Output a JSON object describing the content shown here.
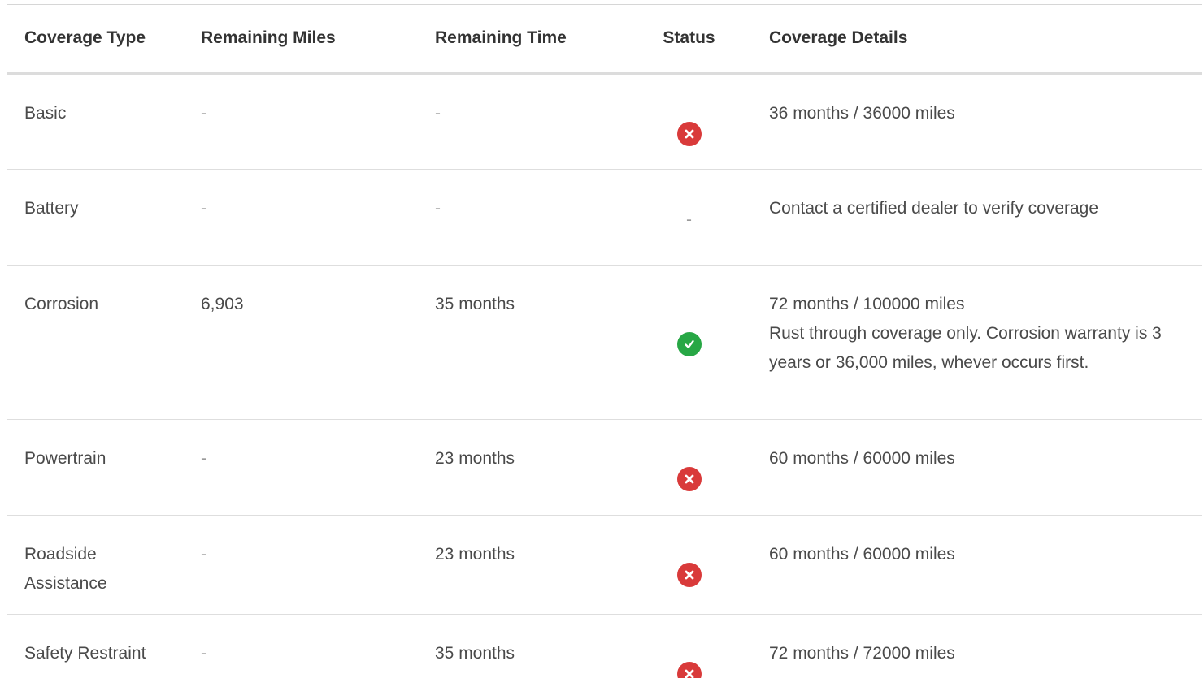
{
  "table": {
    "headers": {
      "coverage_type": "Coverage Type",
      "remaining_miles": "Remaining Miles",
      "remaining_time": "Remaining Time",
      "status": "Status",
      "coverage_details": "Coverage Details"
    },
    "rows": [
      {
        "coverage_type": "Basic",
        "remaining_miles": "-",
        "remaining_time": "-",
        "status": "fail",
        "status_text": "",
        "details_line1": "36 months / 36000 miles",
        "details_line2": ""
      },
      {
        "coverage_type": "Battery",
        "remaining_miles": "-",
        "remaining_time": "-",
        "status": "none",
        "status_text": "-",
        "details_line1": "Contact a certified dealer to verify coverage",
        "details_line2": ""
      },
      {
        "coverage_type": "Corrosion",
        "remaining_miles": "6,903",
        "remaining_time": "35 months",
        "status": "pass",
        "status_text": "",
        "details_line1": "72 months / 100000 miles",
        "details_line2": "Rust through coverage only. Corrosion warranty is 3 years or 36,000 miles, whever occurs first."
      },
      {
        "coverage_type": "Powertrain",
        "remaining_miles": "-",
        "remaining_time": "23 months",
        "status": "fail",
        "status_text": "",
        "details_line1": "60 months / 60000 miles",
        "details_line2": ""
      },
      {
        "coverage_type": "Roadside Assistance",
        "remaining_miles": "-",
        "remaining_time": "23 months",
        "status": "fail",
        "status_text": "",
        "details_line1": "60 months / 60000 miles",
        "details_line2": ""
      },
      {
        "coverage_type": "Safety Restraint",
        "remaining_miles": "-",
        "remaining_time": "35 months",
        "status": "fail",
        "status_text": "",
        "details_line1": "72 months / 72000 miles",
        "details_line2": ""
      }
    ]
  },
  "colors": {
    "fail_icon": "#d93a3a",
    "pass_icon": "#27a745",
    "header_text": "#333333",
    "body_text": "#4a4a4a",
    "row_divider": "#dedede"
  },
  "icons": {
    "fail": "x-circle-icon",
    "pass": "check-circle-icon"
  }
}
